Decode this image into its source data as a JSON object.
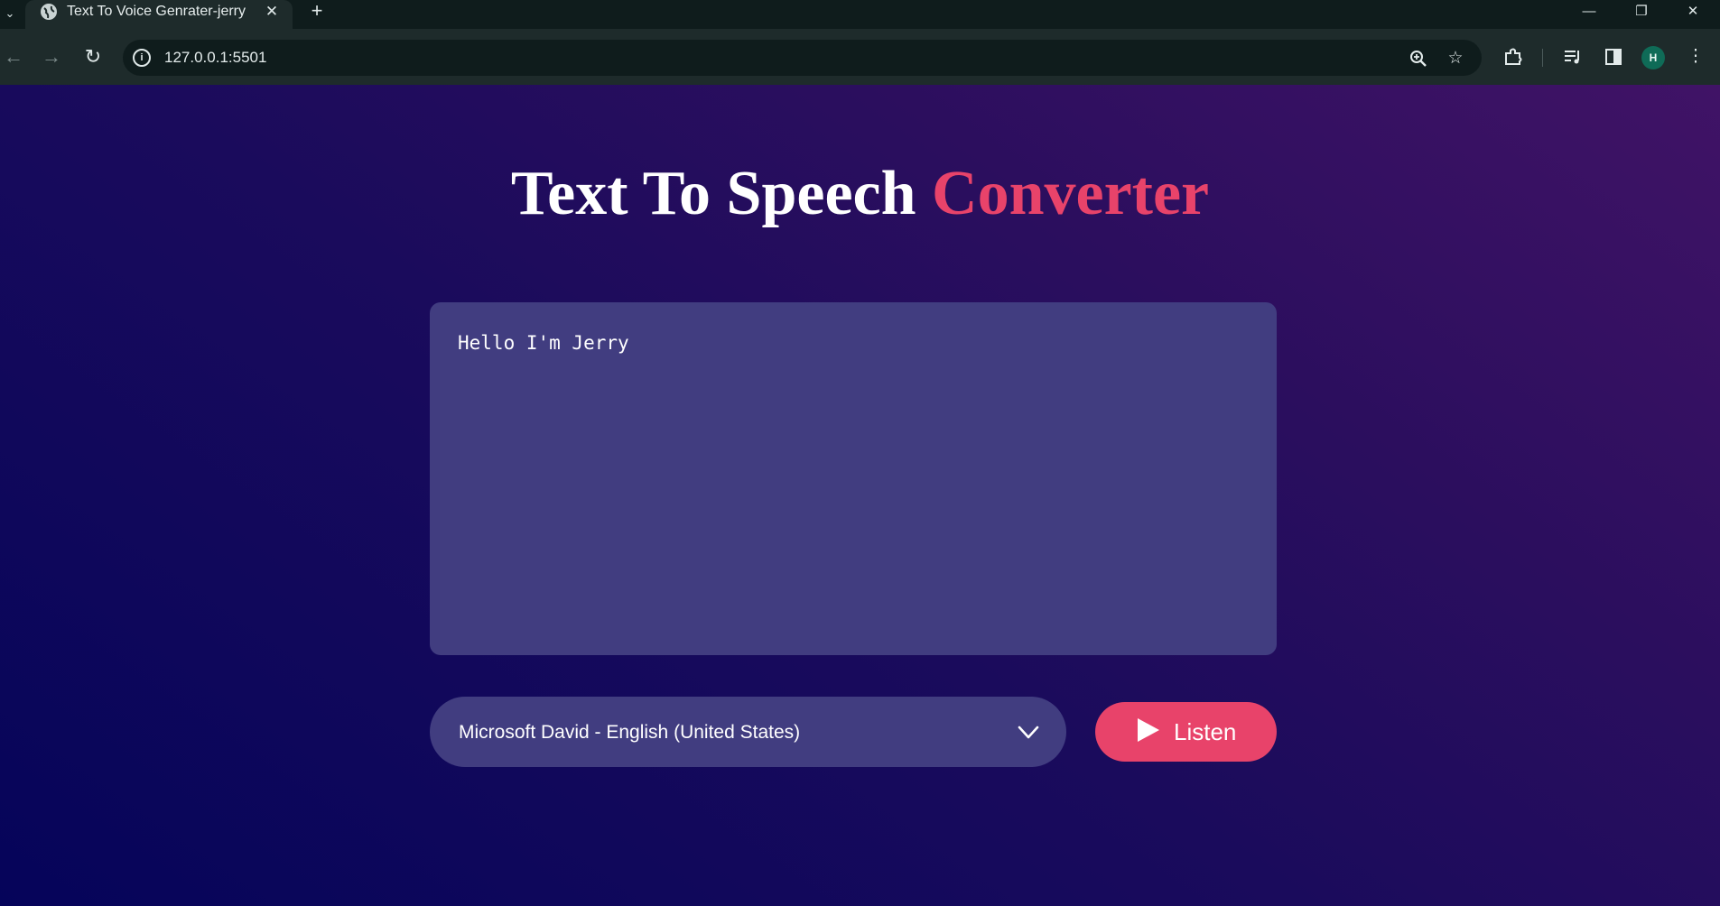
{
  "browser": {
    "tab_title": "Text To Voice Genrater-jerry",
    "tab_close": "✕",
    "new_tab": "+",
    "url": "127.0.0.1:5501",
    "window_controls": {
      "minimize": "—",
      "restore": "❐",
      "close": "✕"
    }
  },
  "page": {
    "heading_main": "Text To Speech ",
    "heading_accent": "Converter",
    "textarea_value": "Hello I'm Jerry",
    "voice_selected": "Microsoft David - English (United States)",
    "listen_label": "Listen"
  },
  "colors": {
    "accent": "#e8436a",
    "panel": "#413d80",
    "bg_start": "#05045a",
    "bg_end": "#401366"
  }
}
